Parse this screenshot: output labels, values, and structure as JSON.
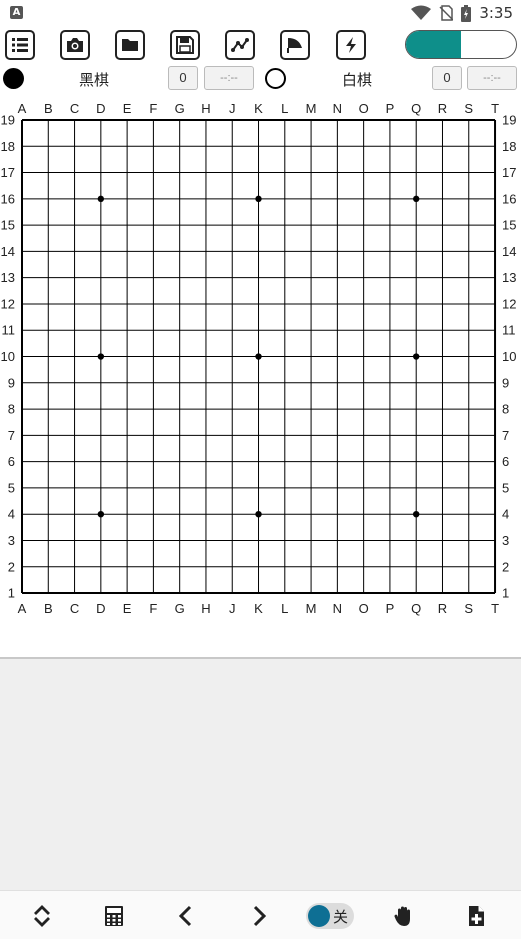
{
  "status_bar": {
    "notification_icon_letter": "A",
    "time": "3:35"
  },
  "toolbar": {
    "icons": [
      "list-icon",
      "camera-icon",
      "folder-icon",
      "save-icon",
      "graph-icon",
      "flag-icon",
      "lightning-icon"
    ],
    "toggle_level": 0.5,
    "accent_color": "#0e8f8a"
  },
  "players": {
    "black": {
      "name": "黑棋",
      "captures": "0",
      "clock": "--:--"
    },
    "white": {
      "name": "白棋",
      "captures": "0",
      "clock": "--:--"
    }
  },
  "board": {
    "size": 19,
    "columns": [
      "A",
      "B",
      "C",
      "D",
      "E",
      "F",
      "G",
      "H",
      "J",
      "K",
      "L",
      "M",
      "N",
      "O",
      "P",
      "Q",
      "R",
      "S",
      "T"
    ],
    "rows": [
      "19",
      "18",
      "17",
      "16",
      "15",
      "14",
      "13",
      "12",
      "11",
      "10",
      "9",
      "8",
      "7",
      "6",
      "5",
      "4",
      "3",
      "2",
      "1"
    ],
    "star_points": [
      [
        "D",
        "16"
      ],
      [
        "K",
        "16"
      ],
      [
        "Q",
        "16"
      ],
      [
        "D",
        "10"
      ],
      [
        "K",
        "10"
      ],
      [
        "Q",
        "10"
      ],
      [
        "D",
        "4"
      ],
      [
        "K",
        "4"
      ],
      [
        "Q",
        "4"
      ]
    ]
  },
  "bottom_bar": {
    "icons": [
      "expand-collapse-icon",
      "calculator-icon",
      "chevron-left-icon",
      "chevron-right-icon",
      "hand-icon",
      "add-board-icon"
    ],
    "switch_label": "关"
  }
}
